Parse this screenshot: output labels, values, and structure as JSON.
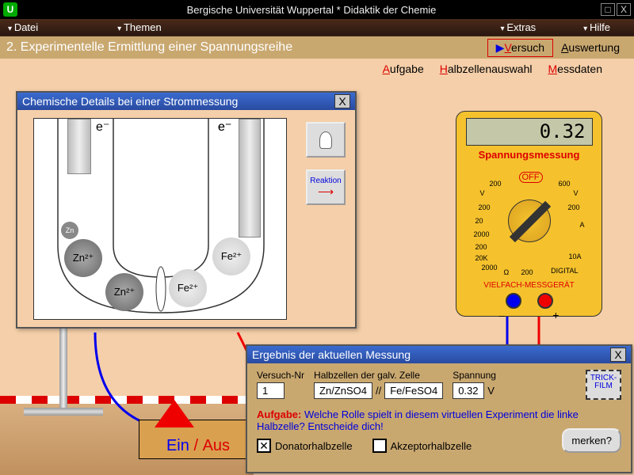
{
  "titlebar": {
    "title": "Bergische Universität Wuppertal   *   Didaktik der Chemie",
    "close": "X"
  },
  "menu": {
    "datei": "Datei",
    "themen": "Themen",
    "extras": "Extras",
    "hilfe": "Hilfe"
  },
  "header": {
    "heading": "2. Experimentelle Ermittlung einer Spannungsreihe",
    "tab_versuch": "ersuch",
    "tab_versuch_u": "V",
    "tab_auswertung": "uswertung",
    "tab_auswertung_u": "A"
  },
  "subnav": {
    "aufgabe": "ufgabe",
    "aufgabe_u": "A",
    "halb": "albzellenauswahl",
    "halb_u": "H",
    "mess": "essdaten",
    "mess_u": "M"
  },
  "chemwin": {
    "title": "Chemische Details bei einer  Strommessung",
    "close": "X",
    "rxn": "Reaktion",
    "ions": {
      "zn": "Zn",
      "zn2": "Zn²⁺",
      "fe2": "Fe²⁺",
      "e": "e⁻"
    }
  },
  "meter": {
    "value": "0.32",
    "label": "Spannungsmessung",
    "off": "OFF",
    "bottom": "VIELFACH-MESSGERÄT",
    "minus": "–",
    "plus": "+",
    "digital": "DIGITAL",
    "omega": "Ω",
    "ticks": {
      "v": "V",
      "a": "A",
      "v2": "V"
    }
  },
  "switch": {
    "ein": "Ein",
    "slash": "/",
    "aus": "Aus"
  },
  "reswin": {
    "title": "Ergebnis der aktuellen Messung",
    "close": "X",
    "versuch_lbl": "Versuch-Nr",
    "versuch_val": "1",
    "halb_lbl": "Halbzellen der galv. Zelle",
    "cell1": "Zn/ZnSO4",
    "sep": "//",
    "cell2": "Fe/FeSO4",
    "spann_lbl": "Spannung",
    "spann_val": "0.32",
    "spann_unit": "V",
    "trick": "TRICK-FILM",
    "aufgabe_lbl": "Aufgabe:",
    "aufgabe_txt": "Welche Rolle spielt in diesem virtuellen Experiment die linke Halbzelle? Entscheide dich!",
    "chk1": "Donatorhalbzelle",
    "chk1_checked": "✕",
    "chk2": "Akzeptorhalbzelle",
    "merken": "merken?"
  }
}
